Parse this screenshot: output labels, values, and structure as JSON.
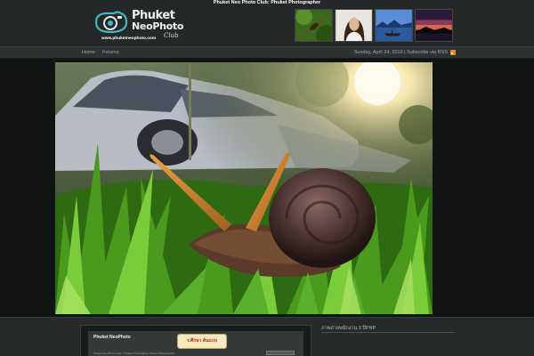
{
  "header": {
    "tagline": "Phuket Neo Photo Club: Phuket Photographer",
    "logo": {
      "line1": "Phuket",
      "line2": "NeoPhoto",
      "script": "Club",
      "url": "www.phuketneophoto.com"
    },
    "thumbnails": [
      {
        "name": "insect-on-twig"
      },
      {
        "name": "woman-portrait"
      },
      {
        "name": "boat-on-sea"
      },
      {
        "name": "sunset-silhouette"
      }
    ]
  },
  "nav": {
    "items": [
      "Home",
      "Forums"
    ],
    "date_text": "Sunday, April 24, 2016 | Subscribe via RSS"
  },
  "main": {
    "photo_subject": "snail-on-grass"
  },
  "bottom": {
    "post_logo": "Phuket NeoPhoto",
    "post_bubble": "ร.ศึกษา ต้นแบบ",
    "post_caption": "Phuket Neo Photo Club - Phuket Photography, Phuket Photographer",
    "sidebar_title": "ภาพถ่ายพนักงาน 3 ปีPNP"
  },
  "colors": {
    "header_bg": "#252828",
    "nav_bg": "#2e3232",
    "body_bg": "#1b1d1d",
    "rss": "#e8892a"
  }
}
